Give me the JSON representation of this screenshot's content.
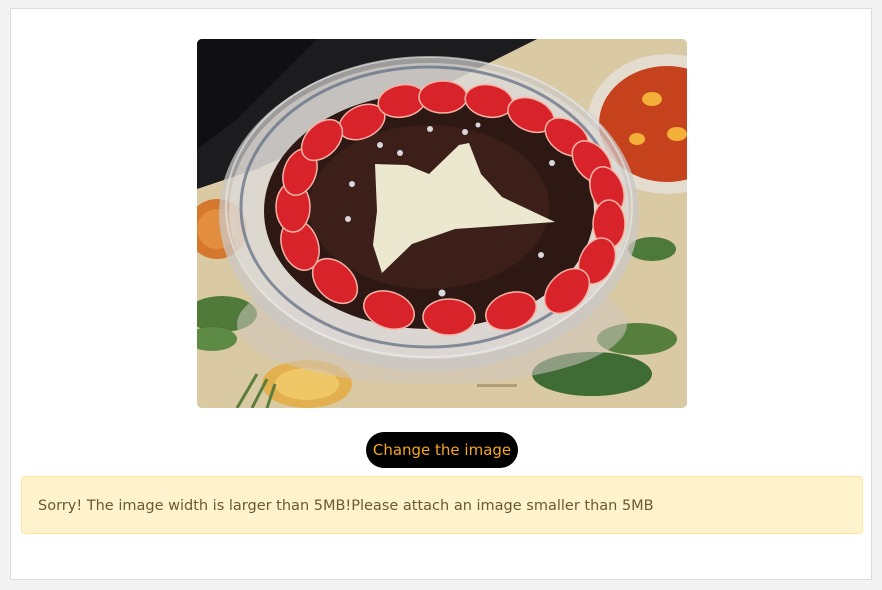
{
  "preview": {
    "alt": "Tiramisu in a glass bowl decorated with strawberries"
  },
  "actions": {
    "change_image_label": "Change the image"
  },
  "alert": {
    "message": "Sorry! The image width is larger than 5MB!Please attach an image smaller than 5MB"
  },
  "colors": {
    "button_bg": "#000000",
    "button_text": "#f5a623",
    "alert_bg": "#fff3cd",
    "alert_border": "#ffe59a",
    "alert_text": "#6b5a2e"
  }
}
